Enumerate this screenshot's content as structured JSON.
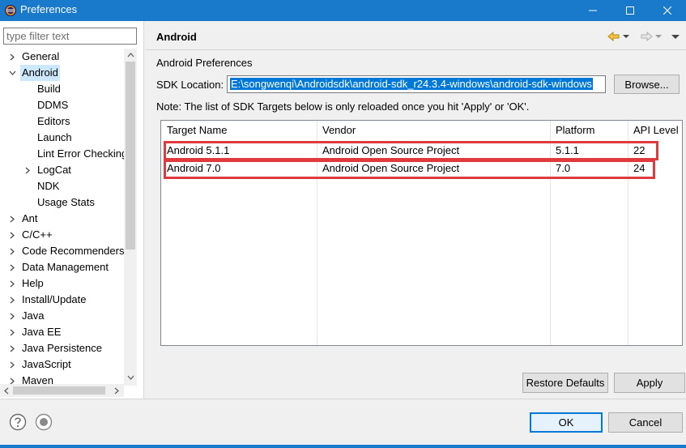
{
  "window": {
    "title": "Preferences",
    "accent_color": "#1979ca",
    "controls": {
      "minimize": "minimize-icon",
      "maximize": "maximize-icon",
      "close": "close-icon"
    }
  },
  "filter": {
    "placeholder": "type filter text",
    "value": ""
  },
  "tree": {
    "items": [
      {
        "label": "General",
        "expanded": false
      },
      {
        "label": "Android",
        "expanded": true,
        "selected": true
      },
      {
        "label": "Build"
      },
      {
        "label": "DDMS"
      },
      {
        "label": "Editors"
      },
      {
        "label": "Launch"
      },
      {
        "label": "Lint Error Checking"
      },
      {
        "label": "LogCat",
        "expanded": false
      },
      {
        "label": "NDK"
      },
      {
        "label": "Usage Stats"
      },
      {
        "label": "Ant",
        "expanded": false
      },
      {
        "label": "C/C++",
        "expanded": false
      },
      {
        "label": "Code Recommenders",
        "expanded": false
      },
      {
        "label": "Data Management",
        "expanded": false
      },
      {
        "label": "Help",
        "expanded": false
      },
      {
        "label": "Install/Update",
        "expanded": false
      },
      {
        "label": "Java",
        "expanded": false
      },
      {
        "label": "Java EE",
        "expanded": false
      },
      {
        "label": "Java Persistence",
        "expanded": false
      },
      {
        "label": "JavaScript",
        "expanded": false
      },
      {
        "label": "Maven",
        "expanded": false
      }
    ]
  },
  "page": {
    "title": "Android",
    "heading": "Android Preferences",
    "sdk_label": "SDK Location:",
    "sdk_value": "E:\\songwenqi\\Androidsdk\\android-sdk_r24.3.4-windows\\android-sdk-windows",
    "browse_label": "Browse...",
    "note": "Note: The list of SDK Targets below is only reloaded once you hit 'Apply' or 'OK'."
  },
  "targets_table": {
    "columns": [
      "Target Name",
      "Vendor",
      "Platform",
      "API Level"
    ],
    "rows": [
      [
        "Android 5.1.1",
        "Android Open Source Project",
        "5.1.1",
        "22"
      ],
      [
        "Android 7.0",
        "Android Open Source Project",
        "7.0",
        "24"
      ]
    ],
    "highlight_color": "#e0393e"
  },
  "buttons": {
    "restore_defaults": "Restore Defaults",
    "apply": "Apply",
    "ok": "OK",
    "cancel": "Cancel"
  }
}
